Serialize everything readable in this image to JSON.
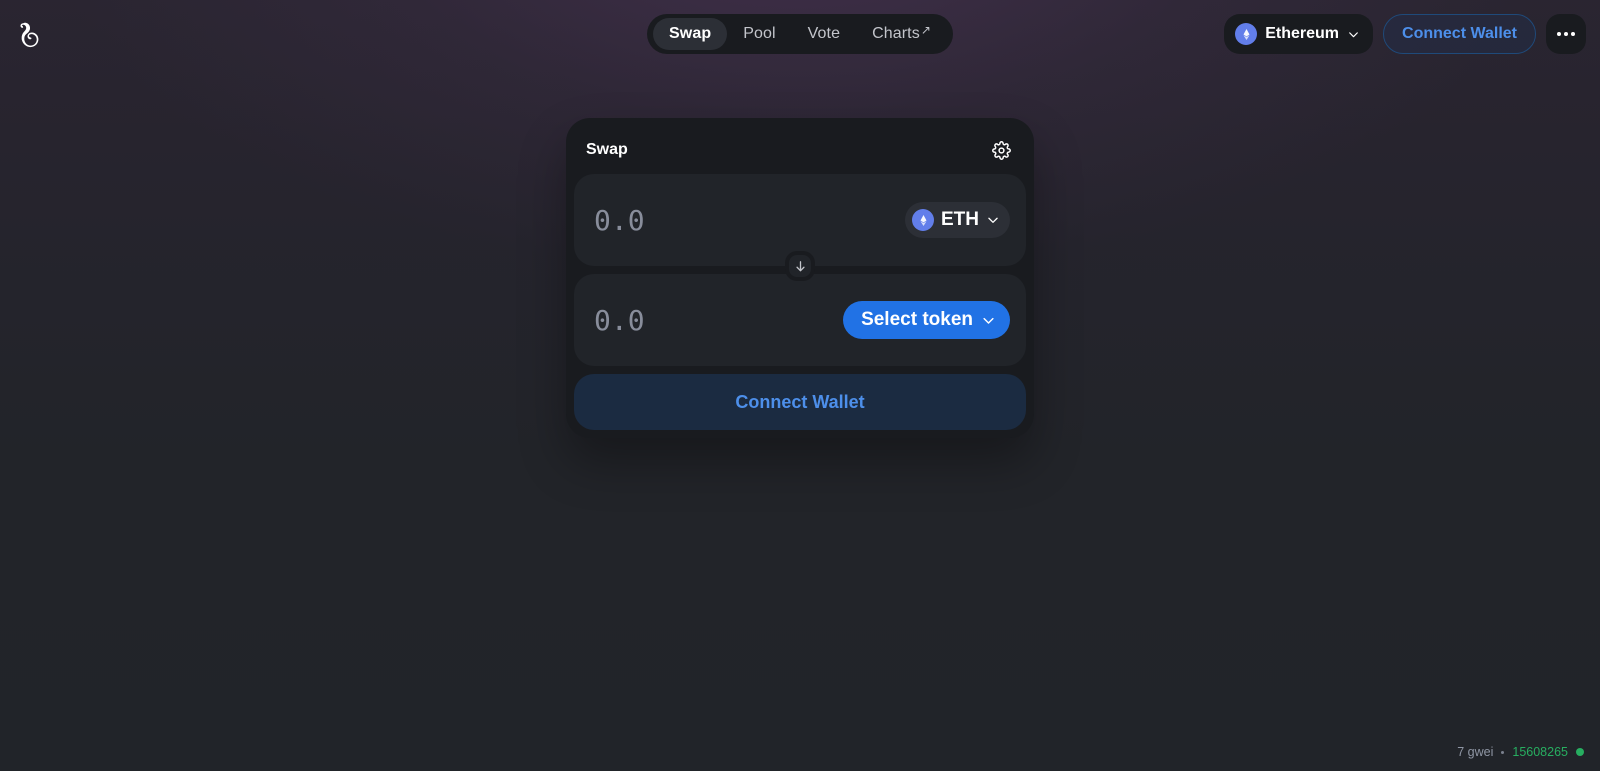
{
  "app": {
    "logo_icon": "uniswap-unicorn-logo"
  },
  "nav": {
    "tabs": [
      {
        "label": "Swap",
        "active": true,
        "external": false
      },
      {
        "label": "Pool",
        "active": false,
        "external": false
      },
      {
        "label": "Vote",
        "active": false,
        "external": false
      },
      {
        "label": "Charts",
        "active": false,
        "external": true,
        "external_glyph": "↗"
      }
    ]
  },
  "header": {
    "chain": {
      "name": "Ethereum",
      "icon": "ethereum-logo-icon",
      "chevron": "chevron-down-icon",
      "accent": "#627eea"
    },
    "connect_wallet_label": "Connect Wallet",
    "more_menu_icon": "ellipsis-icon"
  },
  "swap_card": {
    "title": "Swap",
    "settings_icon": "gear-icon",
    "input_row": {
      "amount": "0.0",
      "amount_placeholder": "0.0",
      "token_symbol": "ETH",
      "token_icon": "ethereum-logo-icon",
      "chevron": "chevron-down-icon"
    },
    "direction_button": {
      "icon": "arrow-down-icon",
      "glyph": "↓"
    },
    "output_row": {
      "amount": "0.0",
      "amount_placeholder": "0.0",
      "select_token_label": "Select token",
      "chevron": "chevron-down-icon"
    },
    "action_button_label": "Connect Wallet"
  },
  "status": {
    "gas_price": "7 gwei",
    "separator": "•",
    "block_number": "15608265",
    "indicator_color": "#27ae60"
  }
}
